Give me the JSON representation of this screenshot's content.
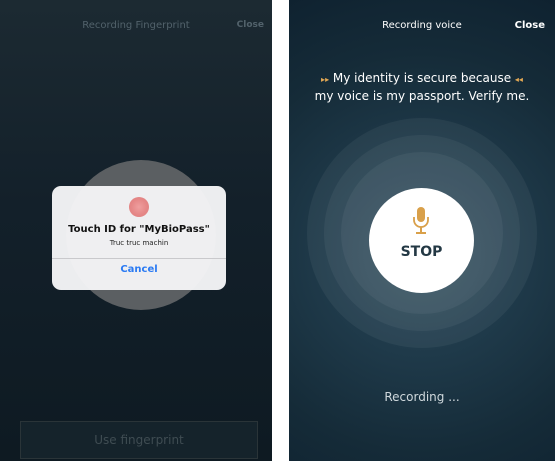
{
  "fingerprint_screen": {
    "title": "Recording Fingerprint",
    "close_label": "Close",
    "dialog": {
      "title": "Touch ID for \"MyBioPass\"",
      "subtitle": "Truc truc machin",
      "cancel_label": "Cancel"
    },
    "use_fingerprint_label": "Use fingerprint"
  },
  "voice_screen": {
    "title": "Recording voice",
    "close_label": "Close",
    "prompt_line1": "My identity is secure because",
    "prompt_line2": "my voice is my passport. Verify me.",
    "arrow_left": "▸▸",
    "arrow_right": "◂◂",
    "stop_label": "STOP",
    "status": "Recording ..."
  },
  "colors": {
    "accent_blue": "#2a7af3",
    "fingerprint_pink": "#e58787",
    "mic_gold": "#d9a04a"
  },
  "icons": [
    "fingerprint-icon",
    "microphone-icon"
  ]
}
